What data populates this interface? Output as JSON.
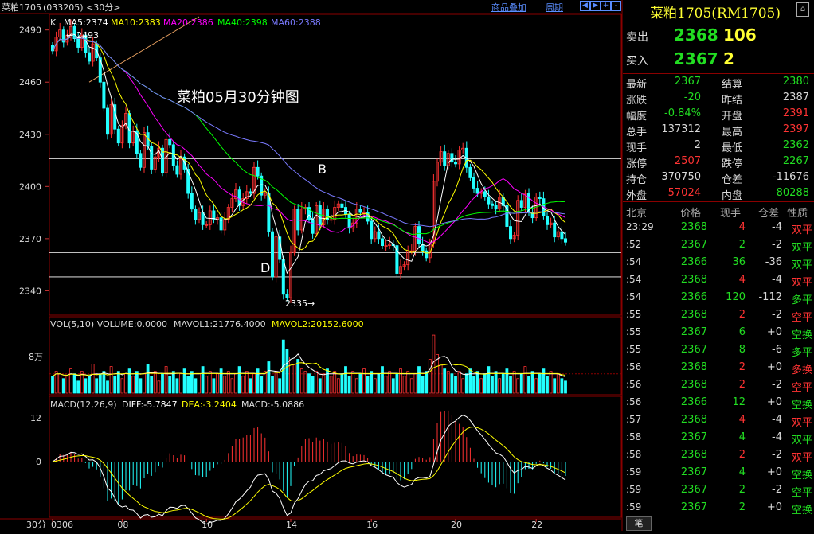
{
  "header": {
    "code": "菜粕1705",
    "sub": "(033205) <30分>",
    "links": [
      "商品叠加",
      "周期"
    ],
    "nav_icons": [
      "left-arrow-icon",
      "right-arrow-icon",
      "zoom-in-icon",
      "zoom-out-icon"
    ]
  },
  "chart_data": {
    "type": "candlestick",
    "title": "菜粕05月30分钟图",
    "price_axis": {
      "ticks": [
        2490,
        2460,
        2430,
        2400,
        2370,
        2340
      ],
      "ylim": [
        2326,
        2499
      ]
    },
    "x_ticks": [
      "0306",
      "08",
      "10",
      "14",
      "16",
      "20",
      "22"
    ],
    "x_axis_label": "30分",
    "ma_legend": {
      "K": "K",
      "MA5": "MA5:2374",
      "MA10": "MA10:2383",
      "MA20": "MA20:2386",
      "MA40": "MA40:2398",
      "MA60": "MA60:2388"
    },
    "annotations": {
      "high": "2493",
      "low": "2335",
      "B": "B",
      "D": "D"
    },
    "hlines": [
      2486,
      2416,
      2362,
      2348
    ],
    "closes": [
      2478,
      2486,
      2490,
      2483,
      2487,
      2492,
      2485,
      2480,
      2487,
      2477,
      2472,
      2482,
      2474,
      2460,
      2445,
      2430,
      2447,
      2433,
      2425,
      2435,
      2442,
      2425,
      2432,
      2419,
      2411,
      2431,
      2423,
      2410,
      2417,
      2422,
      2408,
      2427,
      2424,
      2412,
      2407,
      2417,
      2410,
      2396,
      2387,
      2381,
      2385,
      2378,
      2378,
      2386,
      2381,
      2382,
      2375,
      2381,
      2388,
      2393,
      2398,
      2389,
      2393,
      2397,
      2396,
      2411,
      2406,
      2395,
      2396,
      2374,
      2348,
      2371,
      2358,
      2338,
      2336,
      2362,
      2387,
      2375,
      2387,
      2388,
      2381,
      2373,
      2389,
      2378,
      2387,
      2381,
      2381,
      2388,
      2390,
      2388,
      2384,
      2376,
      2379,
      2387,
      2385,
      2385,
      2380,
      2370,
      2374,
      2370,
      2366,
      2366,
      2367,
      2366,
      2350,
      2354,
      2355,
      2363,
      2363,
      2377,
      2367,
      2363,
      2359,
      2367,
      2403,
      2414,
      2420,
      2412,
      2419,
      2414,
      2413,
      2421,
      2422,
      2411,
      2405,
      2399,
      2396,
      2397,
      2394,
      2390,
      2389,
      2387,
      2394,
      2389,
      2377,
      2370,
      2372,
      2392,
      2388,
      2396,
      2385,
      2382,
      2394,
      2393,
      2383,
      2378,
      2379,
      2371,
      2374,
      2370,
      2368
    ],
    "volume": {
      "legend": "VOL(5,10) VOLUME:0.0000",
      "mavol1": "MAVOL1:21776.4000",
      "mavol2": "MAVOL2:20152.6000",
      "tick": "8万",
      "values": [
        7,
        9,
        8,
        6,
        7,
        10,
        8,
        5,
        9,
        6,
        7,
        12,
        6,
        8,
        9,
        5,
        11,
        7,
        9,
        6,
        8,
        10,
        7,
        9,
        6,
        8,
        12,
        7,
        9,
        5,
        8,
        11,
        7,
        9,
        6,
        8,
        10,
        7,
        9,
        6,
        8,
        11,
        7,
        9,
        6,
        8,
        10,
        7,
        9,
        6,
        8,
        11,
        7,
        9,
        6,
        8,
        10,
        7,
        9,
        13,
        7,
        9,
        6,
        22,
        18,
        15,
        12,
        14,
        10,
        9,
        8,
        7,
        9,
        6,
        8,
        10,
        7,
        9,
        6,
        8,
        11,
        7,
        9,
        6,
        8,
        10,
        7,
        9,
        6,
        8,
        11,
        7,
        9,
        6,
        8,
        10,
        7,
        9,
        6,
        8,
        11,
        7,
        9,
        14,
        24,
        16,
        12,
        10,
        9,
        8,
        7,
        9,
        6,
        8,
        10,
        7,
        9,
        6,
        8,
        11,
        7,
        9,
        6,
        8,
        10,
        7,
        9,
        6,
        8,
        11,
        7,
        9,
        6,
        8,
        10,
        7,
        9,
        6,
        8,
        6,
        5
      ]
    },
    "macd": {
      "legend": "MACD(12,26,9)",
      "diff": "DIFF:-5.7847",
      "dea": "DEA:-3.2404",
      "macd": "MACD:-5.0886",
      "ticks": [
        12,
        0
      ]
    }
  },
  "quote": {
    "title": "菜粕1705(RM1705)",
    "sell": {
      "label": "卖出",
      "price": "2368",
      "vol": "106"
    },
    "buy": {
      "label": "买入",
      "price": "2367",
      "vol": "2"
    },
    "rows": [
      {
        "l1": "最新",
        "v1": "2367",
        "c1": "grn",
        "l2": "结算",
        "v2": "2380",
        "c2": "grn"
      },
      {
        "l1": "涨跌",
        "v1": "-20",
        "c1": "grn",
        "l2": "昨结",
        "v2": "2387",
        "c2": "wht"
      },
      {
        "l1": "幅度",
        "v1": "-0.84%",
        "c1": "grn",
        "l2": "开盘",
        "v2": "2391",
        "c2": "red"
      },
      {
        "l1": "总手",
        "v1": "137312",
        "c1": "wht",
        "l2": "最高",
        "v2": "2397",
        "c2": "red"
      },
      {
        "l1": "现手",
        "v1": "2",
        "c1": "wht",
        "l2": "最低",
        "v2": "2362",
        "c2": "grn"
      },
      {
        "l1": "涨停",
        "v1": "2507",
        "c1": "red",
        "l2": "跌停",
        "v2": "2267",
        "c2": "grn"
      },
      {
        "l1": "持仓",
        "v1": "370750",
        "c1": "wht",
        "l2": "仓差",
        "v2": "-11676",
        "c2": "wht"
      },
      {
        "l1": "外盘",
        "v1": "57024",
        "c1": "red",
        "l2": "内盘",
        "v2": "80288",
        "c2": "grn"
      }
    ],
    "tick_header": [
      "北京",
      "价格",
      "现手",
      "仓差",
      "性质"
    ],
    "ticks": [
      {
        "t": "23:29",
        "p": "2368",
        "pc": "grn",
        "v": "4",
        "vc": "red",
        "d": "-4",
        "n": "双平",
        "nc": "red"
      },
      {
        "t": ":52",
        "p": "2367",
        "pc": "grn",
        "v": "2",
        "vc": "grn",
        "d": "-2",
        "n": "双平",
        "nc": "grn"
      },
      {
        "t": ":54",
        "p": "2366",
        "pc": "grn",
        "v": "36",
        "vc": "grn",
        "d": "-36",
        "n": "双平",
        "nc": "grn"
      },
      {
        "t": ":54",
        "p": "2368",
        "pc": "grn",
        "v": "4",
        "vc": "red",
        "d": "-4",
        "n": "双平",
        "nc": "red"
      },
      {
        "t": ":54",
        "p": "2366",
        "pc": "grn",
        "v": "120",
        "vc": "grn",
        "d": "-112",
        "n": "多平",
        "nc": "grn"
      },
      {
        "t": ":55",
        "p": "2368",
        "pc": "grn",
        "v": "2",
        "vc": "red",
        "d": "-2",
        "n": "空平",
        "nc": "red"
      },
      {
        "t": ":55",
        "p": "2367",
        "pc": "grn",
        "v": "6",
        "vc": "grn",
        "d": "+0",
        "n": "空换",
        "nc": "grn"
      },
      {
        "t": ":55",
        "p": "2367",
        "pc": "grn",
        "v": "8",
        "vc": "grn",
        "d": "-6",
        "n": "多平",
        "nc": "grn"
      },
      {
        "t": ":56",
        "p": "2368",
        "pc": "grn",
        "v": "2",
        "vc": "red",
        "d": "+0",
        "n": "多换",
        "nc": "red"
      },
      {
        "t": ":56",
        "p": "2368",
        "pc": "grn",
        "v": "2",
        "vc": "red",
        "d": "-2",
        "n": "空平",
        "nc": "red"
      },
      {
        "t": ":56",
        "p": "2366",
        "pc": "grn",
        "v": "12",
        "vc": "grn",
        "d": "+0",
        "n": "空换",
        "nc": "grn"
      },
      {
        "t": ":57",
        "p": "2368",
        "pc": "grn",
        "v": "4",
        "vc": "red",
        "d": "-4",
        "n": "双平",
        "nc": "red"
      },
      {
        "t": ":58",
        "p": "2367",
        "pc": "grn",
        "v": "4",
        "vc": "grn",
        "d": "-4",
        "n": "双平",
        "nc": "grn"
      },
      {
        "t": ":58",
        "p": "2368",
        "pc": "grn",
        "v": "2",
        "vc": "red",
        "d": "-2",
        "n": "双平",
        "nc": "red"
      },
      {
        "t": ":59",
        "p": "2367",
        "pc": "grn",
        "v": "4",
        "vc": "grn",
        "d": "+0",
        "n": "空换",
        "nc": "grn"
      },
      {
        "t": ":59",
        "p": "2367",
        "pc": "grn",
        "v": "2",
        "vc": "grn",
        "d": "-2",
        "n": "空平",
        "nc": "grn"
      },
      {
        "t": ":59",
        "p": "2367",
        "pc": "grn",
        "v": "2",
        "vc": "grn",
        "d": "+0",
        "n": "空换",
        "nc": "grn"
      }
    ],
    "footer_tab": "笔"
  },
  "colors": {
    "up": "#ff3232",
    "down": "#22ffff",
    "ma5": "#ffffff",
    "ma10": "#ffff00",
    "ma20": "#ff00ff",
    "ma40": "#00ff00",
    "ma60": "#7a7aff",
    "grid": "#8b0000"
  }
}
